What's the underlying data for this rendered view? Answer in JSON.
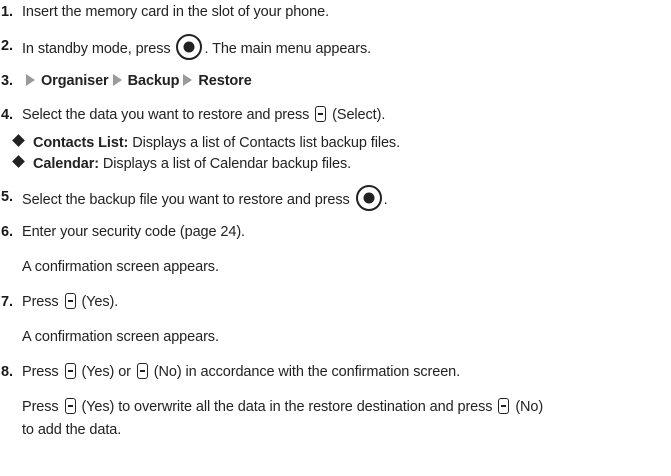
{
  "steps": [
    {
      "num": "1.",
      "text": "Insert the memory card in the slot of your phone."
    },
    {
      "num": "2.",
      "a": "In standby mode, press",
      "b": ". The main menu appears."
    },
    {
      "num": "3.",
      "path": [
        "Organiser",
        "Backup",
        "Restore"
      ]
    },
    {
      "num": "4.",
      "a": "Select the data you want to restore and press",
      "b": "(Select)."
    },
    {
      "num": "5.",
      "a": "Select the backup file you want to restore and press",
      "b": "."
    },
    {
      "num": "6.",
      "text": "Enter your security code (page 24)."
    },
    {
      "num": "7.",
      "a": "Press",
      "b": "(Yes)."
    },
    {
      "num": "8.",
      "a": "Press",
      "b": "(Yes) or",
      "c": "(No) in accordance with the confirmation screen."
    }
  ],
  "bullets": [
    {
      "term": "Contacts List:",
      "desc": "Displays a list of Contacts list backup files."
    },
    {
      "term": "Calendar:",
      "desc": "Displays a list of Calendar backup files."
    }
  ],
  "notes": {
    "confirm1": "A confirmation screen appears.",
    "confirm2": "A confirmation screen appears.",
    "p8_a": "Press",
    "p8_b": "(Yes) to overwrite all the data in the restore destination and press",
    "p8_c": "(No)",
    "p8_d": "to add the data."
  },
  "icons": {
    "center_key": "center-select-key-icon",
    "soft_key": "soft-key-icon",
    "arrow": "menu-arrow-icon",
    "bullet": "diamond-bullet-icon"
  }
}
